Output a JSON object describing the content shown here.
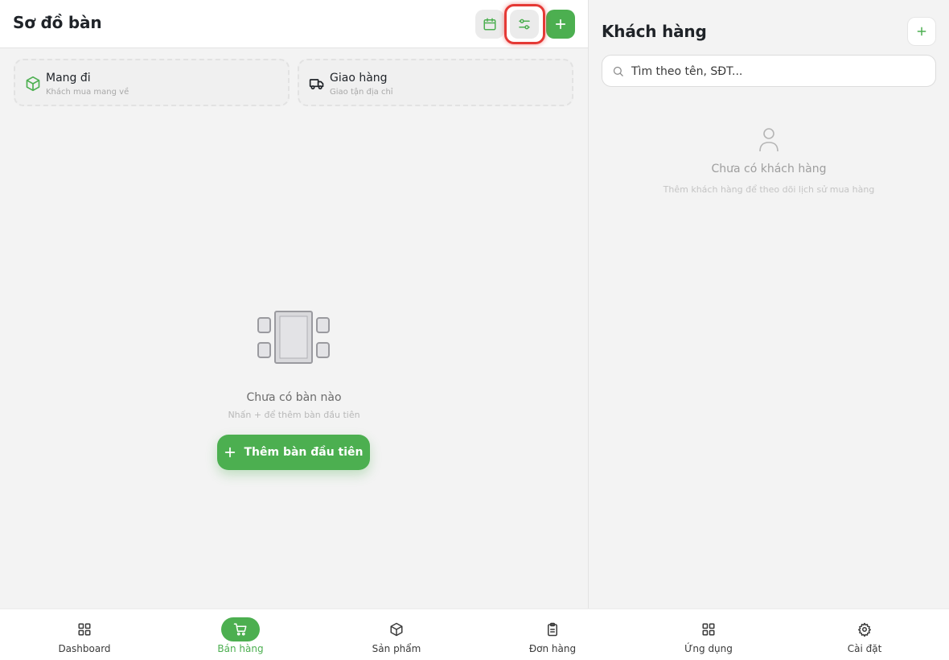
{
  "left_panel": {
    "title": "Sơ đồ bàn",
    "header_buttons": {
      "calendar_icon": "calendar-icon",
      "filter_icon": "sliders-icon",
      "add_icon": "plus-icon"
    },
    "modes": [
      {
        "title": "Mang đi",
        "subtitle": "Khách mua mang về",
        "icon": "package-icon"
      },
      {
        "title": "Giao hàng",
        "subtitle": "Giao tận địa chỉ",
        "icon": "truck-icon"
      }
    ],
    "empty_state": {
      "title": "Chưa có bàn nào",
      "subtitle": "Nhấn + để thêm bàn đầu tiên",
      "button_label": "Thêm bàn đầu tiên"
    }
  },
  "right_panel": {
    "title": "Khách hàng",
    "search_placeholder": "Tìm theo tên, SĐT...",
    "empty_state": {
      "title": "Chưa có khách hàng",
      "subtitle": "Thêm khách hàng để theo dõi lịch sử mua hàng"
    }
  },
  "bottom_nav": [
    {
      "label": "Dashboard",
      "icon": "grid-icon",
      "active": false
    },
    {
      "label": "Bán hàng",
      "icon": "cart-icon",
      "active": true
    },
    {
      "label": "Sản phẩm",
      "icon": "box-icon",
      "active": false
    },
    {
      "label": "Đơn hàng",
      "icon": "clipboard-icon",
      "active": false
    },
    {
      "label": "Ứng dụng",
      "icon": "apps-icon",
      "active": false
    },
    {
      "label": "Cài đặt",
      "icon": "gear-icon",
      "active": false
    }
  ],
  "colors": {
    "accent": "#4caf50",
    "highlight": "#e53935",
    "panel_background": "#f3f3f3"
  }
}
